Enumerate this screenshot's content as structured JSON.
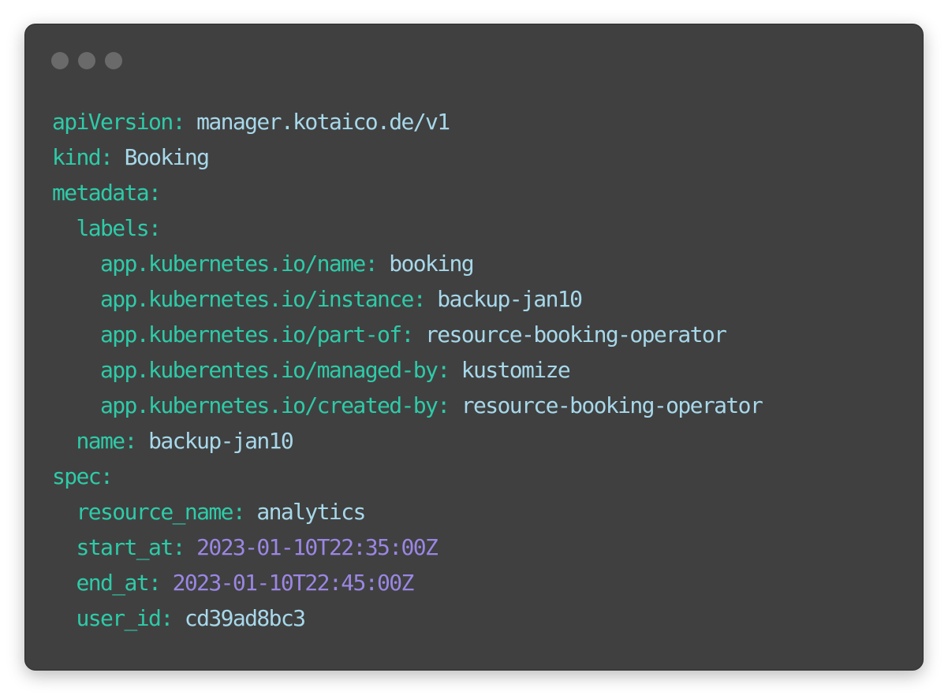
{
  "window": {
    "controls": [
      "window-dot",
      "window-dot",
      "window-dot"
    ]
  },
  "colors": {
    "background": "#404040",
    "key": "#2ecba8",
    "value": "#a7d8ea",
    "timestamp": "#9b86e3",
    "window_dot": "#6a6a6a"
  },
  "code": {
    "lines": [
      {
        "indent": "",
        "key": "apiVersion:",
        "sep": " ",
        "value": "manager.kotaico.de/v1",
        "value_type": "str"
      },
      {
        "indent": "",
        "key": "kind:",
        "sep": " ",
        "value": "Booking",
        "value_type": "str"
      },
      {
        "indent": "",
        "key": "metadata:",
        "sep": "",
        "value": "",
        "value_type": "str"
      },
      {
        "indent": "  ",
        "key": "labels:",
        "sep": "",
        "value": "",
        "value_type": "str"
      },
      {
        "indent": "    ",
        "key": "app.kubernetes.io/name:",
        "sep": " ",
        "value": "booking",
        "value_type": "str"
      },
      {
        "indent": "    ",
        "key": "app.kubernetes.io/instance:",
        "sep": " ",
        "value": "backup-jan10",
        "value_type": "str"
      },
      {
        "indent": "    ",
        "key": "app.kubernetes.io/part-of:",
        "sep": " ",
        "value": "resource-booking-operator",
        "value_type": "str"
      },
      {
        "indent": "    ",
        "key": "app.kuberentes.io/managed-by:",
        "sep": " ",
        "value": "kustomize",
        "value_type": "str"
      },
      {
        "indent": "    ",
        "key": "app.kubernetes.io/created-by:",
        "sep": " ",
        "value": "resource-booking-operator",
        "value_type": "str"
      },
      {
        "indent": "  ",
        "key": "name:",
        "sep": " ",
        "value": "backup-jan10",
        "value_type": "str"
      },
      {
        "indent": "",
        "key": "spec:",
        "sep": "",
        "value": "",
        "value_type": "str"
      },
      {
        "indent": "  ",
        "key": "resource_name:",
        "sep": " ",
        "value": "analytics",
        "value_type": "str"
      },
      {
        "indent": "  ",
        "key": "start_at:",
        "sep": " ",
        "value": "2023-01-10T22:35:00Z",
        "value_type": "date"
      },
      {
        "indent": "  ",
        "key": "end_at:",
        "sep": " ",
        "value": "2023-01-10T22:45:00Z",
        "value_type": "date"
      },
      {
        "indent": "  ",
        "key": "user_id:",
        "sep": " ",
        "value": "cd39ad8bc3",
        "value_type": "str"
      }
    ]
  }
}
